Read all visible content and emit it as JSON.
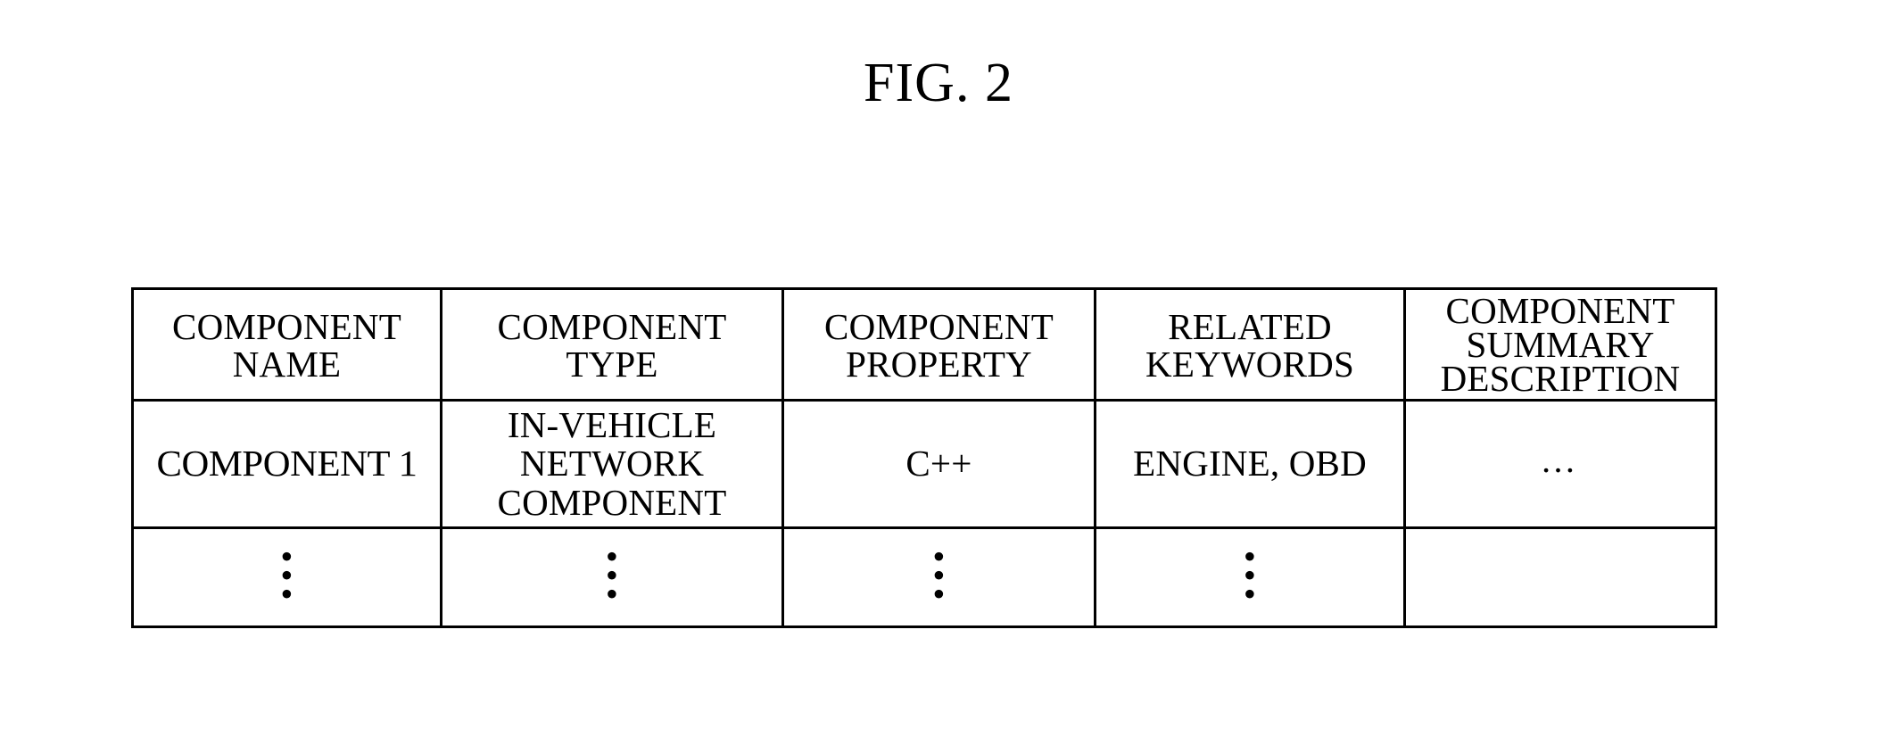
{
  "figure": {
    "title": "FIG. 2"
  },
  "table": {
    "headers": [
      {
        "lines": [
          "COMPONENT",
          "NAME"
        ]
      },
      {
        "lines": [
          "COMPONENT",
          "TYPE"
        ]
      },
      {
        "lines": [
          "COMPONENT",
          "PROPERTY"
        ]
      },
      {
        "lines": [
          "RELATED",
          "KEYWORDS"
        ]
      },
      {
        "lines": [
          "COMPONENT",
          "SUMMARY",
          "DESCRIPTION"
        ]
      }
    ],
    "rows": [
      {
        "cells": [
          {
            "lines": [
              "COMPONENT 1"
            ]
          },
          {
            "lines": [
              "IN-VEHICLE",
              "NETWORK",
              "COMPONENT"
            ]
          },
          {
            "lines": [
              "C++"
            ]
          },
          {
            "lines": [
              "ENGINE, OBD"
            ]
          },
          {
            "lines": [
              "…"
            ]
          }
        ]
      },
      {
        "cells": [
          {
            "lines": [
              "⋮"
            ]
          },
          {
            "lines": [
              "⋮"
            ]
          },
          {
            "lines": [
              "⋮"
            ]
          },
          {
            "lines": [
              "⋮"
            ]
          },
          {
            "lines": [
              ""
            ]
          }
        ]
      }
    ]
  },
  "dot": "•"
}
